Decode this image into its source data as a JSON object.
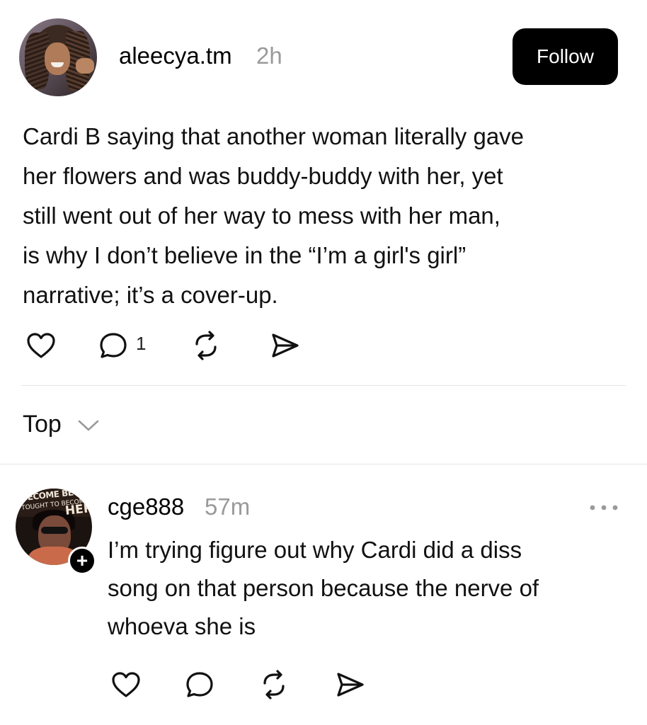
{
  "post": {
    "username": "aleecya.tm",
    "time": "2h",
    "follow_label": "Follow",
    "lines": [
      "Cardi B saying that another woman literally gave",
      "her flowers and was buddy-buddy with her, yet",
      "still went out of her way to mess with her man,",
      "is why I don’t believe in the “I’m a girl's girl”",
      "narrative; it’s a cover-up."
    ],
    "actions": {
      "like_icon": "heart-icon",
      "comment_icon": "comment-icon",
      "comment_count": "1",
      "repost_icon": "repost-icon",
      "share_icon": "share-icon"
    }
  },
  "sort": {
    "label": "Top",
    "icon": "chevron-down-icon"
  },
  "reply": {
    "username": "cge888",
    "time": "57m",
    "avatar_text": [
      "BECOME BEC",
      "TOUGHT TO BECOME",
      "HER"
    ],
    "follow_badge": "+",
    "more_icon": "more-icon",
    "lines": [
      "I’m trying figure out why Cardi did a diss",
      "song on that person because the nerve of",
      "whoeva she is"
    ],
    "actions": {
      "like_icon": "heart-icon",
      "comment_icon": "comment-icon",
      "repost_icon": "repost-icon",
      "share_icon": "share-icon"
    }
  },
  "colors": {
    "text": "#111111",
    "muted": "#9a9a9a",
    "button_bg": "#000000",
    "button_text": "#ffffff",
    "divider": "#e4e4e4"
  }
}
